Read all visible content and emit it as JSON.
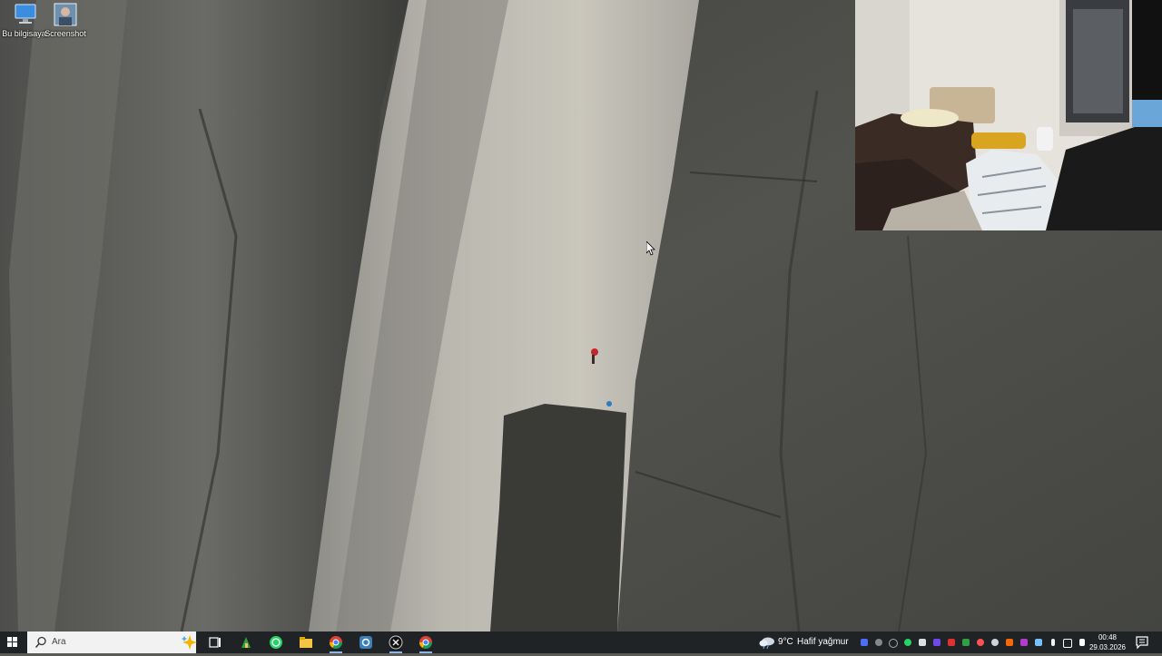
{
  "desktop": {
    "icons": [
      {
        "label": "Bu bilgisayar",
        "icon": "this-pc-icon"
      },
      {
        "label": "Screenshot",
        "icon": "screenshot-image-icon"
      }
    ]
  },
  "webcam": {
    "icon": "webcam-feed"
  },
  "taskbar": {
    "start_icon": "windows-start-icon",
    "search": {
      "placeholder": "Ara"
    },
    "apps": [
      {
        "name": "task-view",
        "icon": "task-view-icon"
      },
      {
        "name": "app-green",
        "icon": "app-icon"
      },
      {
        "name": "whatsapp",
        "icon": "whatsapp-icon"
      },
      {
        "name": "file-explorer",
        "icon": "folder-icon"
      },
      {
        "name": "chrome",
        "icon": "chrome-icon"
      },
      {
        "name": "app-settings",
        "icon": "gear-app-icon"
      },
      {
        "name": "app-dark",
        "icon": "app-icon"
      },
      {
        "name": "chrome-2",
        "icon": "chrome-icon"
      }
    ],
    "weather": {
      "temp": "9°C",
      "condition": "Hafif yağmur"
    },
    "clock": {
      "time": "00:48",
      "date": "29.03.2026"
    }
  }
}
